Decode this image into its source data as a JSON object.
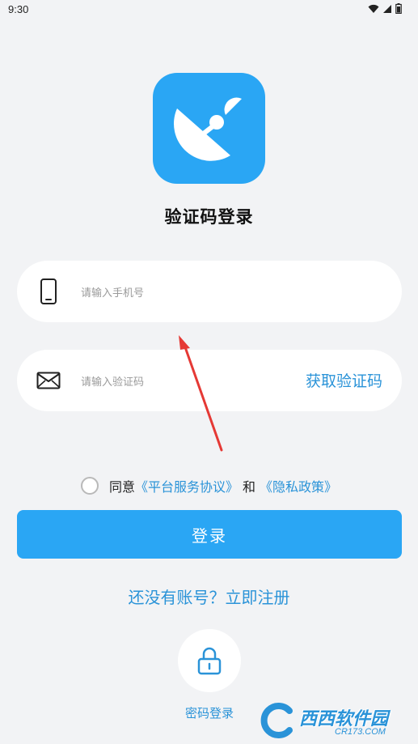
{
  "status_bar": {
    "time": "9:30",
    "icons": [
      "wifi-icon",
      "signal-icon",
      "battery-icon"
    ]
  },
  "logo": {
    "icon": "satellite-dish-icon",
    "background_color": "#2aa6f4"
  },
  "title": "验证码登录",
  "phone_field": {
    "icon": "phone-icon",
    "value": "",
    "placeholder": "请输入手机号"
  },
  "code_field": {
    "icon": "mail-icon",
    "value": "",
    "placeholder": "请输入验证码",
    "get_code_label": "获取验证码"
  },
  "agreement": {
    "checked": false,
    "prefix": "同意",
    "service_link": "《平台服务协议》",
    "joiner": "和",
    "privacy_link": "《隐私政策》"
  },
  "login_button_label": "登录",
  "register_link": "还没有账号？立即注册",
  "password_login": {
    "icon": "lock-icon",
    "label": "密码登录"
  },
  "watermark": {
    "main": "西西软件园",
    "sub": "CR173.COM"
  },
  "colors": {
    "primary": "#2aa6f4",
    "link": "#2a93d8",
    "background": "#f2f3f5",
    "annotation_arrow": "#e53935"
  }
}
